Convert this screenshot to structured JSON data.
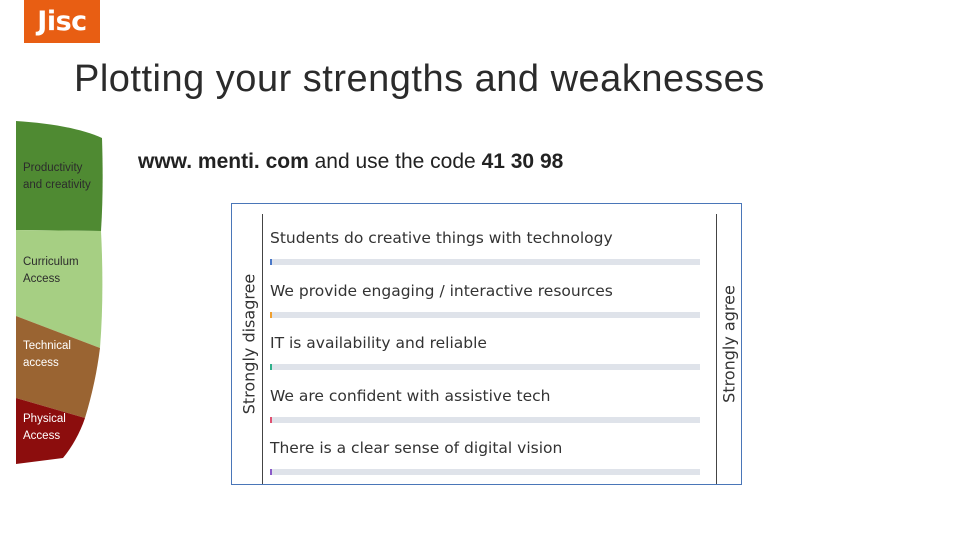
{
  "brand": {
    "logo_text": "Jisc",
    "color": "#e85e13"
  },
  "slide": {
    "title": "Plotting your strengths and weaknesses",
    "instruction": {
      "url": "www. menti. com",
      "middle": " and use the code ",
      "code": "41 30 98"
    }
  },
  "ladder": {
    "levels": [
      {
        "label": "Productivity and creativity",
        "color": "#4f8a32"
      },
      {
        "label": "Curriculum Access",
        "color": "#a6cf83"
      },
      {
        "label": "Technical access",
        "color": "#9a6432"
      },
      {
        "label": "Physical Access",
        "color": "#8c0d0d"
      }
    ]
  },
  "poll": {
    "left_label": "Strongly disagree",
    "right_label": "Strongly agree",
    "statements": [
      {
        "text": "Students do creative things with technology",
        "marker_color": "#4a78c8"
      },
      {
        "text": "We provide engaging / interactive resources",
        "marker_color": "#f0a030"
      },
      {
        "text": "IT is availability and reliable",
        "marker_color": "#2fb08a"
      },
      {
        "text": "We are confident with assistive tech",
        "marker_color": "#e05070"
      },
      {
        "text": "There is a clear sense of digital vision",
        "marker_color": "#8a5ac8"
      }
    ]
  }
}
